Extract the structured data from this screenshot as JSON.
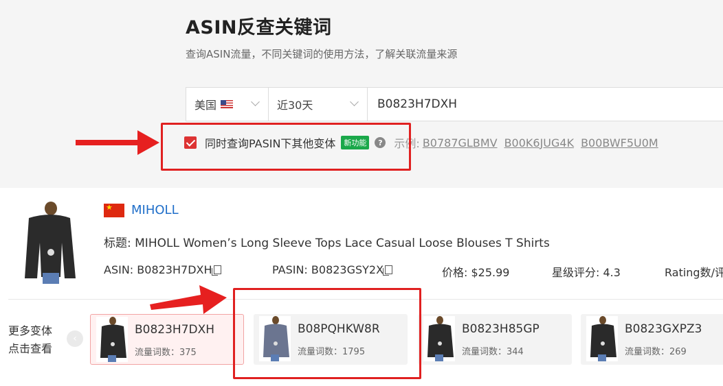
{
  "header": {
    "title": "ASIN反查关键词",
    "subtitle": "查询ASIN流量，不同关键词的使用方法，了解关联流量来源"
  },
  "search": {
    "country": "美国",
    "country_flag_icon": "us-flag-icon",
    "period": "近30天",
    "asin_value": "B0823H7DXH"
  },
  "options": {
    "variant_query_label": "同时查询PASIN下其他变体",
    "variant_query_checked": true,
    "new_badge": "新功能",
    "help_icon": "question-circle-icon",
    "example_label": "示例:",
    "examples": [
      "B0787GLBMV",
      "B00K6JUG4K",
      "B00BWF5U0M"
    ]
  },
  "product": {
    "brand_flag_icon": "china-flag-icon",
    "brand": "MIHOLL",
    "title_label": "标题:",
    "title": "MIHOLL Women’s Long Sleeve Tops Lace Casual Loose Blouses T Shirts",
    "asin_label": "ASIN:",
    "asin": "B0823H7DXH",
    "pasin_label": "PASIN:",
    "pasin": "B0823GSY2X",
    "price_label": "价格:",
    "price": "$25.99",
    "rating_label": "星级评分:",
    "rating": "4.3",
    "rating_count_label": "Rating数/评"
  },
  "variants": {
    "section_label_line1": "更多变体",
    "section_label_line2": "点击查看",
    "count_label": "流量词数：",
    "items": [
      {
        "asin": "B0823H7DXH",
        "count": "375",
        "active": true,
        "color": "#2a2a2a"
      },
      {
        "asin": "B08PQHKW8R",
        "count": "1795",
        "active": false,
        "color": "#6b7590"
      },
      {
        "asin": "B0823H85GP",
        "count": "344",
        "active": false,
        "color": "#2a2a2a"
      },
      {
        "asin": "B0823GXPZ3",
        "count": "269",
        "active": false,
        "color": "#2a2a2a"
      }
    ]
  },
  "colors": {
    "accent_red": "#e02020",
    "brand_blue": "#1f6ec9",
    "badge_green": "#1aa84a"
  }
}
